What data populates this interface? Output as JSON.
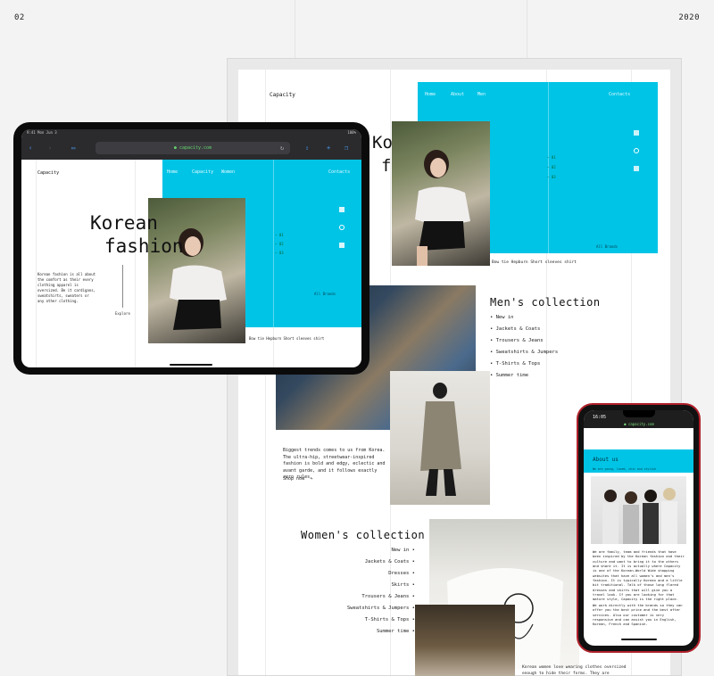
{
  "corners": {
    "left": "02",
    "right": "2020"
  },
  "page": {
    "logo": "Capacity",
    "nav": [
      "Home",
      "About",
      "Men",
      "Contacts"
    ],
    "hero_title_line1": "Korean",
    "hero_title_line2": "fashion",
    "all_brands": "All Brands",
    "product_caption": "Bow tie Hepburn Short sleeves shirt",
    "mens": {
      "title": "Men's collection",
      "items": [
        "New in",
        "Jackets & Coats",
        "Trousers & Jeans",
        "Sweatshirts & Jumpers",
        "T-Shirts & Tops",
        "Summer time"
      ]
    },
    "trend_text": "Biggest trends comes to us from Korea. The ultra-hip, streetwear-inspired fashion is bold and edgy, eclectic and avant garde, and it follows exactly zero rules.",
    "shop_now": "Shop now",
    "womens": {
      "title": "Women's collection",
      "items": [
        "New in",
        "Jackets & Coats",
        "Dresses",
        "Skirts",
        "Trousers & Jeans",
        "Sweatshirts & Jumpers",
        "T-Shirts & Tops",
        "Summer time"
      ]
    },
    "women_caption": "Korean women love wearing clothes oversized enough to hide their forms. They are generally"
  },
  "tablet": {
    "status_time": "9:41 Mon Jun 3",
    "battery": "100%",
    "aa": "AA",
    "url": "capacity.com",
    "logo": "Capacity",
    "nav": [
      "Home",
      "Capacity",
      "Women",
      "Contacts"
    ],
    "title1": "Korean",
    "title2": "fashion",
    "intro": "Korean fashion is all about the comfort as their every clothing apparel is oversized. Be it cardigans, sweatshirts, sweaters or any other clothing.",
    "explore": "Explore",
    "all_brands": "All Brands",
    "caption": "Bow tie Hepburn Short sleeves shirt"
  },
  "phone": {
    "time": "16:05",
    "url": "capacity.com",
    "heading": "About us",
    "subline": "We are young, loved, chic and stylish",
    "body": "We are family, team and friends that have been inspired by the Korean fashion and their culture and want to bring it to the others and share it. It is actually where Capacity is one of the Korean-World Wide shopping websites that have all women's and men's fashion. It is typically Korean and a little bit traditional. Talk of those long flared dresses and skirts that will give you a travel look. If you are looking for that mature style, Capacity is the right place.",
    "body2": "We work directly with the brands so they can offer you the best price and the best after services. Also our customer is very responsive and can assist you in English, Korean, French and Spanish."
  }
}
